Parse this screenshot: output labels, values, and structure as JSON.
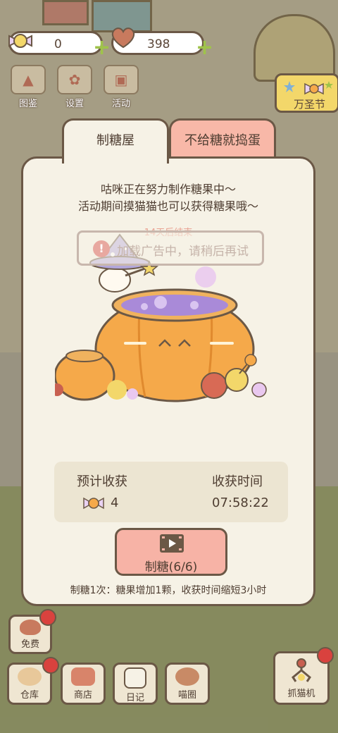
{
  "currency": {
    "candy": "0",
    "hearts": "398"
  },
  "top_menu": [
    {
      "label": "图鉴"
    },
    {
      "label": "设置"
    },
    {
      "label": "活动"
    }
  ],
  "event_badge": {
    "label": "万圣节"
  },
  "tabs": [
    {
      "label": "制糖屋",
      "active": true
    },
    {
      "label": "不给糖就捣蛋",
      "active": false
    }
  ],
  "panel": {
    "desc_line1": "咕咪正在努力制作糖果中～",
    "desc_line2": "活动期间摸猫猫也可以获得糖果哦～",
    "timer": "14天后结束",
    "toast": "加载广告中，请稍后再试",
    "expected_label": "预计收获",
    "expected_value": "4",
    "harvest_label": "收获时间",
    "harvest_value": "07:58:22",
    "make_button": "制糖(6/6)",
    "note": "制糖1次：糖果增加1颗，收获时间缩短3小时"
  },
  "bottom_bar": {
    "free": "免费",
    "warehouse": "仓库",
    "shop": "商店",
    "diary": "日记",
    "circle": "喵圈",
    "claw": "抓猫机"
  },
  "colors": {
    "panel_bg": "#f6f2e6",
    "outline": "#6b5846",
    "pumpkin": "#f5a94a",
    "active_tab": "#f6f2e6",
    "inactive_tab": "#f8b8a8",
    "accent_button": "#f7b3a6"
  }
}
